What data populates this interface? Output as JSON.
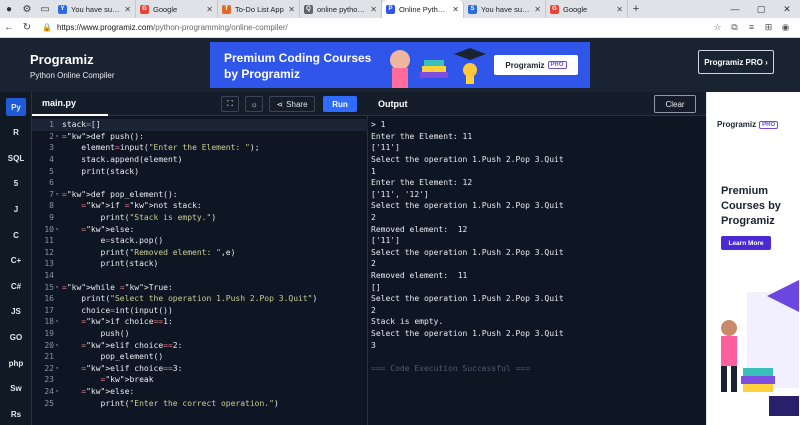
{
  "browser": {
    "tabs": [
      {
        "title": "You have successfull",
        "fav_color": "#2d6be3",
        "fav_glyph": "Y",
        "active": false
      },
      {
        "title": "Google",
        "fav_color": "#ea4335",
        "fav_glyph": "G",
        "active": false
      },
      {
        "title": "To-Do List App",
        "fav_color": "#e06a2c",
        "fav_glyph": "T",
        "active": false
      },
      {
        "title": "online python comp",
        "fav_color": "#5f6368",
        "fav_glyph": "Q",
        "active": false
      },
      {
        "title": "Online Python Comp",
        "fav_color": "#2f56e8",
        "fav_glyph": "P",
        "active": true
      },
      {
        "title": "You have successfull",
        "fav_color": "#2d6be3",
        "fav_glyph": "S",
        "active": false
      },
      {
        "title": "Google",
        "fav_color": "#ea4335",
        "fav_glyph": "G",
        "active": false
      }
    ],
    "url_host": "https://www.programiz.com",
    "url_path": "/python-programming/online-compiler/"
  },
  "header": {
    "logo": "Programiz",
    "subtitle": "Python Online Compiler",
    "banner_title": "Premium Coding Courses by Programiz",
    "banner_logo": "Programiz",
    "banner_pro": "PRO",
    "pro_button": "Programiz PRO ›"
  },
  "sidebar": {
    "items": [
      {
        "label": "Py",
        "icon": "python-icon"
      },
      {
        "label": "R",
        "icon": "r-icon"
      },
      {
        "label": "SQL",
        "icon": "sql-icon"
      },
      {
        "label": "5",
        "icon": "html-icon"
      },
      {
        "label": "J",
        "icon": "java-icon"
      },
      {
        "label": "C",
        "icon": "c-icon"
      },
      {
        "label": "C+",
        "icon": "cpp-icon"
      },
      {
        "label": "C#",
        "icon": "csharp-icon"
      },
      {
        "label": "JS",
        "icon": "javascript-icon"
      },
      {
        "label": "GO",
        "icon": "go-icon"
      },
      {
        "label": "php",
        "icon": "php-icon"
      },
      {
        "label": "Sw",
        "icon": "swift-icon"
      },
      {
        "label": "Rs",
        "icon": "rust-icon"
      }
    ]
  },
  "editor": {
    "filename": "main.py",
    "share_label": "Share",
    "run_label": "Run",
    "lines": [
      "stack=[]",
      "def push():",
      "    element=input(\"Enter the Element: \");",
      "    stack.append(element)",
      "    print(stack)",
      "",
      "def pop_element():",
      "    if not stack:",
      "        print(\"Stack is empty.\")",
      "    else:",
      "        e=stack.pop()",
      "        print(\"Removed element: \",e)",
      "        print(stack)",
      "",
      "while True:",
      "    print(\"Select the operation 1.Push 2.Pop 3.Quit\")",
      "    choice=int(input())",
      "    if choice==1:",
      "        push()",
      "    elif choice==2:",
      "        pop_element()",
      "    elif choice==3:",
      "        break",
      "    else:",
      "        print(\"Enter the correct operation.\")"
    ]
  },
  "output": {
    "title": "Output",
    "clear_label": "Clear",
    "lines": [
      "> 1",
      "Enter the Element: 11",
      "['11']",
      "Select the operation 1.Push 2.Pop 3.Quit",
      "1",
      "Enter the Element: 12",
      "['11', '12']",
      "Select the operation 1.Push 2.Pop 3.Quit",
      "2",
      "Removed element:  12",
      "['11']",
      "Select the operation 1.Push 2.Pop 3.Quit",
      "2",
      "Removed element:  11",
      "[]",
      "Select the operation 1.Push 2.Pop 3.Quit",
      "2",
      "Stack is empty.",
      "Select the operation 1.Push 2.Pop 3.Quit",
      "3",
      "",
      "=== Code Execution Successful ==="
    ]
  },
  "ad": {
    "logo": "Programiz",
    "pro": "PRO",
    "text": "Premium Courses by Programiz",
    "button": "Learn More"
  }
}
